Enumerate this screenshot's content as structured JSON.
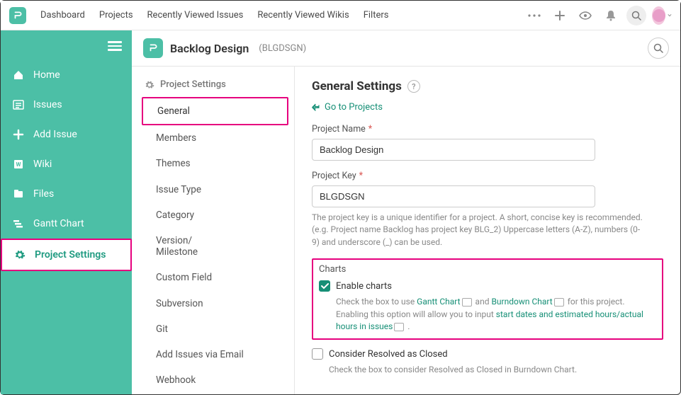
{
  "topnav": {
    "items": [
      "Dashboard",
      "Projects",
      "Recently Viewed Issues",
      "Recently Viewed Wikis",
      "Filters"
    ]
  },
  "sidebar": {
    "items": [
      {
        "label": "Home"
      },
      {
        "label": "Issues"
      },
      {
        "label": "Add Issue"
      },
      {
        "label": "Wiki"
      },
      {
        "label": "Files"
      },
      {
        "label": "Gantt Chart"
      },
      {
        "label": "Project Settings"
      }
    ]
  },
  "project": {
    "name": "Backlog Design",
    "key_display": "(BLGDSGN)"
  },
  "subnav": {
    "title": "Project Settings",
    "items": [
      "General",
      "Members",
      "Themes",
      "Issue Type",
      "Category",
      "Version/\nMilestone",
      "Custom Field",
      "Subversion",
      "Git",
      "Add Issues via Email",
      "Webhook"
    ]
  },
  "panel": {
    "title": "General Settings",
    "back": "Go to Projects",
    "project_name_label": "Project Name",
    "project_name_value": "Backlog Design",
    "project_key_label": "Project Key",
    "project_key_value": "BLGDSGN",
    "project_key_hint": "The project key is a unique identifier for a project. A short, concise key is recommended. (e.g. Project name Backlog has project key BLG_2) Uppercase letters (A-Z), numbers (0-9) and underscore (_) can be used.",
    "charts_title": "Charts",
    "enable_charts_label": "Enable charts",
    "charts_hint_1": "Check the box to use ",
    "charts_link_1": "Gantt Chart",
    "charts_hint_2": " and ",
    "charts_link_2": "Burndown Chart",
    "charts_hint_3": " for this project. Enabling this option will allow you to input ",
    "charts_link_3": "start dates and estimated hours/actual hours in issues",
    "charts_hint_4": " .",
    "resolved_label": "Consider Resolved as Closed",
    "resolved_hint": "Check the box to consider Resolved as Closed in Burndown Chart."
  }
}
